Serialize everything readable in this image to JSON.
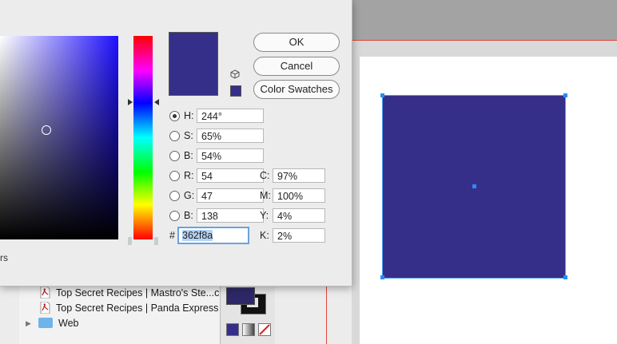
{
  "dialog": {
    "partial_label": "rs",
    "buttons": {
      "ok": "OK",
      "cancel": "Cancel",
      "swatches": "Color Swatches"
    },
    "current_color": "#362f8a",
    "hsb": {
      "h": {
        "label": "H:",
        "value": "244°",
        "selected": true
      },
      "s": {
        "label": "S:",
        "value": "65%"
      },
      "b": {
        "label": "B:",
        "value": "54%"
      }
    },
    "rgb": {
      "r": {
        "label": "R:",
        "value": "54"
      },
      "g": {
        "label": "G:",
        "value": "47"
      },
      "b": {
        "label": "B:",
        "value": "138"
      }
    },
    "cmyk": {
      "c": {
        "label": "C:",
        "value": "97%"
      },
      "m": {
        "label": "M:",
        "value": "100%"
      },
      "y": {
        "label": "Y:",
        "value": "4%"
      },
      "k": {
        "label": "K:",
        "value": "2%"
      }
    },
    "hex": {
      "label": "#",
      "value": "362f8a"
    }
  },
  "layers": {
    "items": [
      {
        "label": "Top Secret Recipes | Mastro's Ste...c",
        "icon": "pdf-icon"
      },
      {
        "label": "Top Secret Recipes | Panda Express",
        "icon": "pdf-icon"
      },
      {
        "label": "Web",
        "icon": "folder-icon"
      }
    ]
  },
  "colors": {
    "accent": "#362f8a",
    "selection": "#2a8cf4",
    "guide": "#e2463c"
  }
}
